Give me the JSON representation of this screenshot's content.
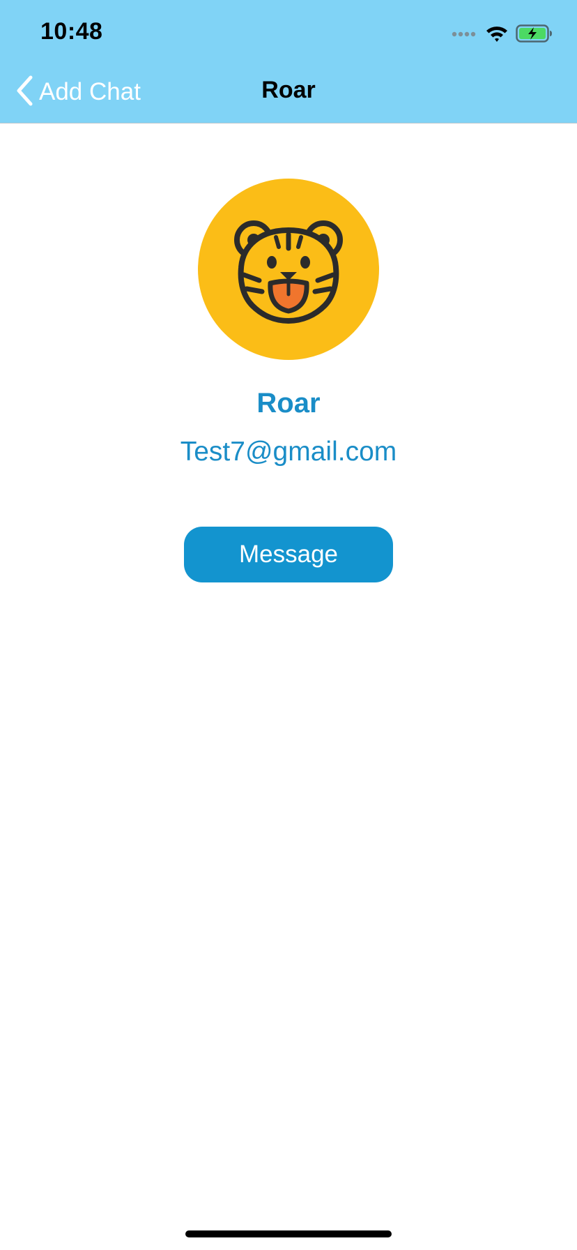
{
  "status_bar": {
    "time": "10:48"
  },
  "nav": {
    "back_label": "Add Chat",
    "title": "Roar"
  },
  "profile": {
    "name": "Roar",
    "email": "Test7@gmail.com",
    "avatar_icon": "tiger-face-icon"
  },
  "actions": {
    "message_label": "Message"
  },
  "colors": {
    "header_bg": "#80d3f6",
    "accent": "#1394cf",
    "text_accent": "#1a8dc7",
    "avatar_bg": "#fbbd17"
  }
}
